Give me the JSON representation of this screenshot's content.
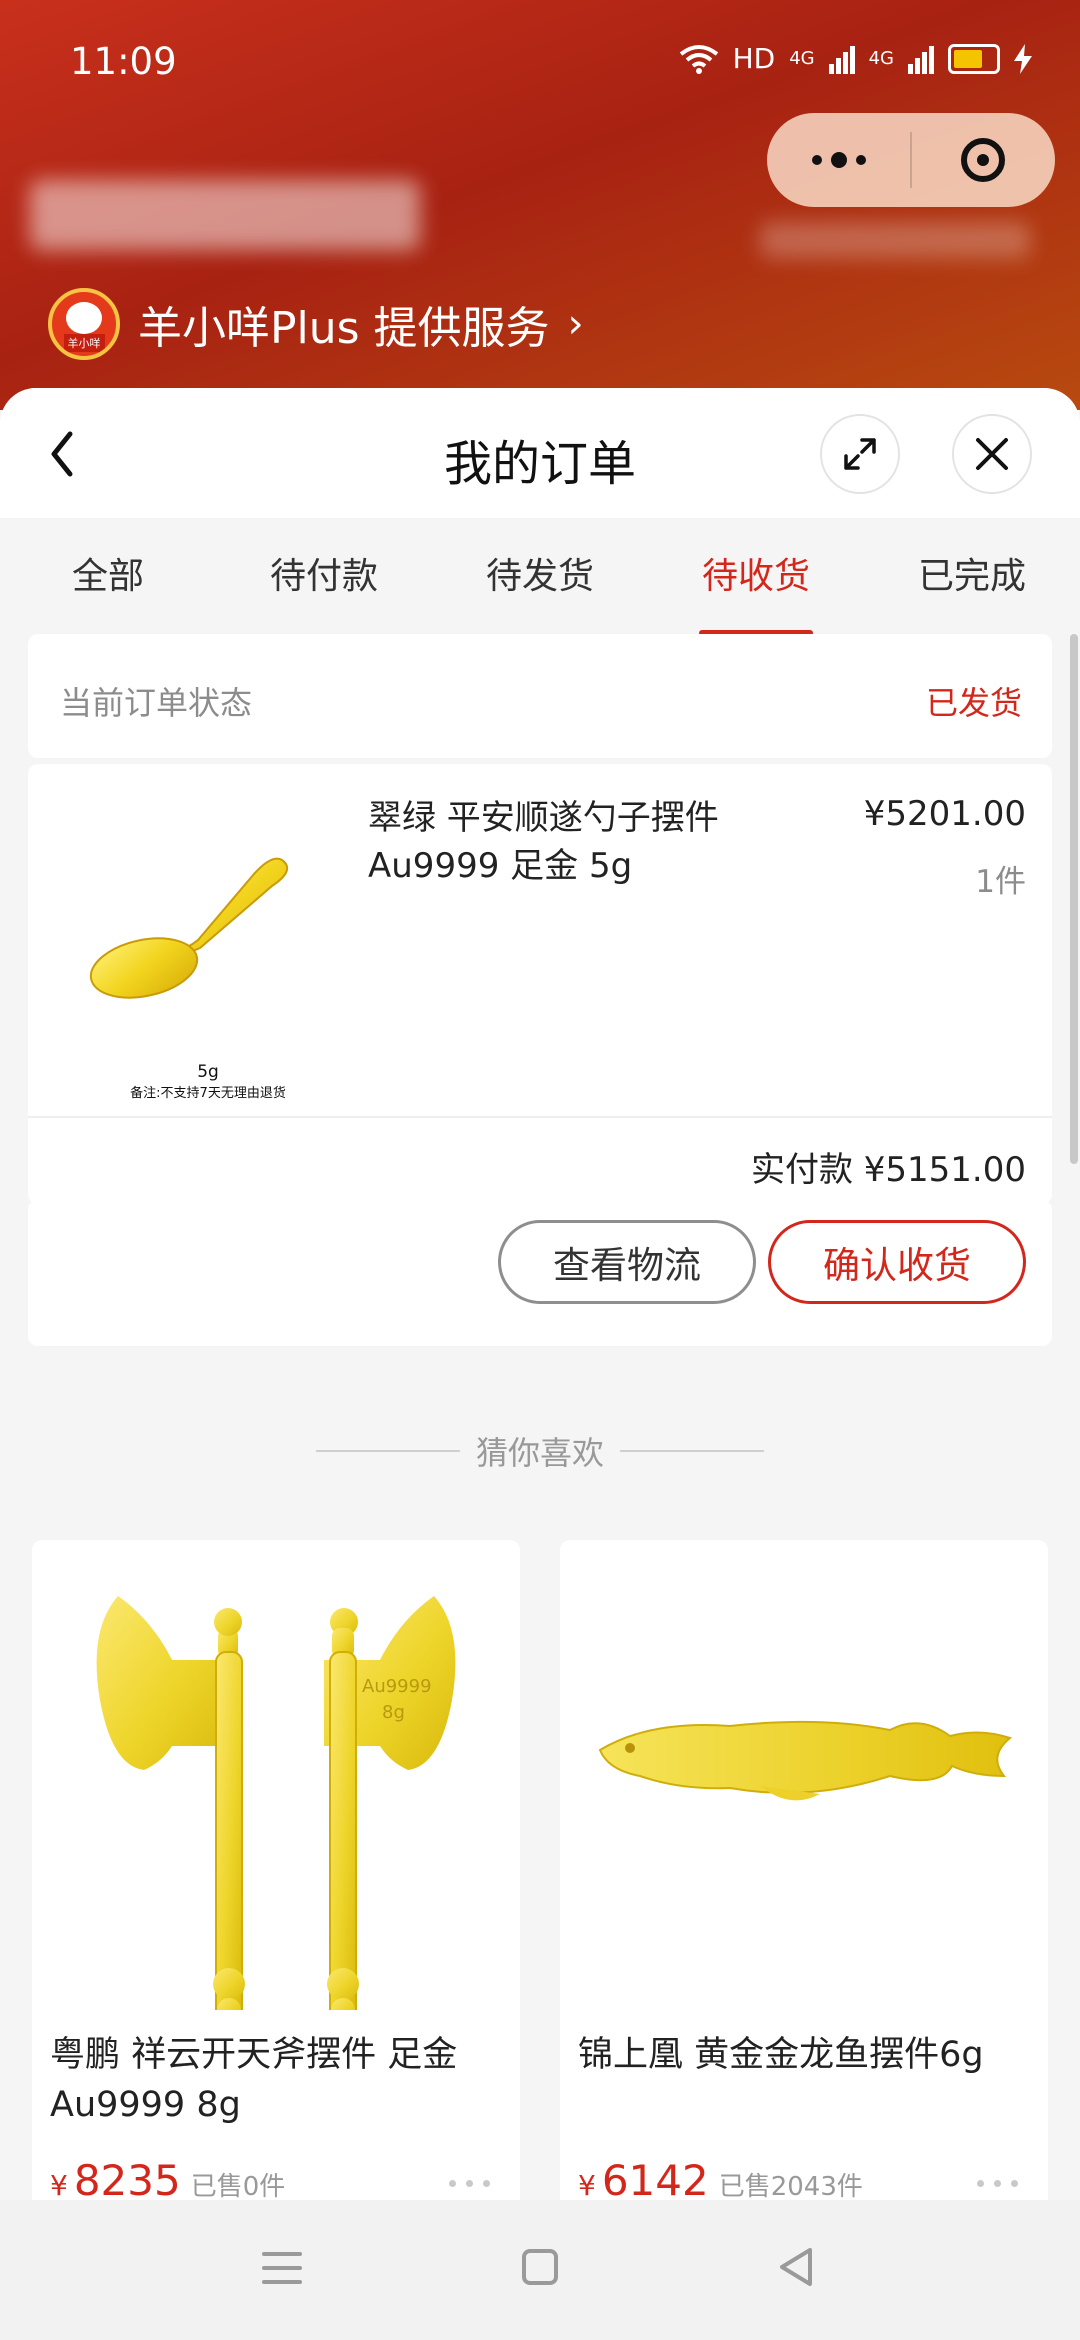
{
  "status_bar": {
    "time": "11:09",
    "network": "HD",
    "signal_1": "4G",
    "signal_2": "4G"
  },
  "capsule": {
    "more_icon": "ellipsis-icon",
    "close_icon": "target-icon"
  },
  "service": {
    "label": "羊小咩Plus 提供服务",
    "chevron": "›",
    "logo_tag": "羊小咩"
  },
  "nav": {
    "title": "我的订单"
  },
  "tabs": [
    {
      "label": "全部"
    },
    {
      "label": "待付款"
    },
    {
      "label": "待发货"
    },
    {
      "label": "待收货",
      "active": true
    },
    {
      "label": "已完成"
    }
  ],
  "order": {
    "status_label": "当前订单状态",
    "status_value": "已发货",
    "product_title": "翠绿 平安顺遂勺子摆件 Au9999 足金 5g",
    "price": "¥5201.00",
    "quantity": "1件",
    "image_caption_weight": "5g",
    "image_caption_note": "备注:不支持7天无理由退货",
    "paid_label": "实付款 ¥5151.00",
    "logistics_button": "查看物流",
    "confirm_button": "确认收货"
  },
  "recommend": {
    "heading": "猜你喜欢",
    "items": [
      {
        "name": "粤鹏 祥云开天斧摆件 足金Au9999 8g",
        "currency": "¥",
        "price": "8235",
        "sold": "已售0件",
        "engraving_1": "Au9999",
        "engraving_2": "8g"
      },
      {
        "name": "锦上凰 黄金金龙鱼摆件6g",
        "currency": "¥",
        "price": "6142",
        "sold": "已售2043件"
      }
    ]
  },
  "colors": {
    "accent": "#d3271c",
    "header_red": "#b02514",
    "gold": "#f3d61c"
  }
}
